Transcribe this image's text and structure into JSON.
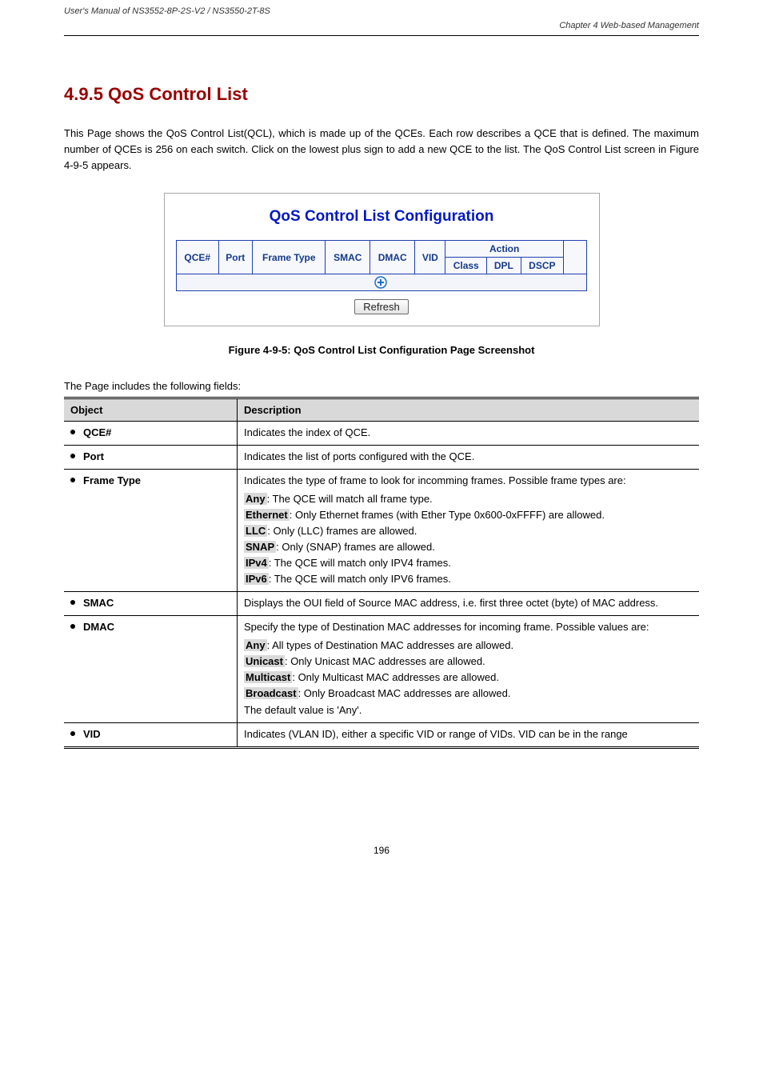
{
  "header": {
    "manual": "User's Manual of NS3552-8P-2S-V2 / NS3550-2T-8S",
    "chapter": "Chapter 4 Web-based Management"
  },
  "section": {
    "heading": "4.9.5 QoS Control List",
    "intro": "This Page shows the QoS Control List(QCL), which is made up of the QCEs. Each row describes a QCE that is defined. The maximum number of QCEs is 256 on each switch. Click on the lowest plus sign to add a new QCE to the list. The QoS Control List screen in Figure 4-9-5 appears."
  },
  "figure": {
    "title": "QoS Control List Configuration",
    "headers": {
      "qce": "QCE#",
      "port": "Port",
      "frame_type": "Frame Type",
      "smac": "SMAC",
      "dmac": "DMAC",
      "vid": "VID",
      "action_group": "Action",
      "class": "Class",
      "dpl": "DPL",
      "dscp": "DSCP"
    },
    "refresh_label": "Refresh",
    "caption_label": "Figure 4-9-5:",
    "caption_text": " QoS Control List Configuration Page Screenshot"
  },
  "lead": "The Page includes the following fields:",
  "table": {
    "head_object": "Object",
    "head_description": "Description",
    "rows": [
      {
        "obj": "QCE#",
        "desc_plain": "Indicates the index of QCE."
      },
      {
        "obj": "Port",
        "desc_plain": "Indicates the list of ports configured with the QCE."
      },
      {
        "obj": "Frame Type",
        "desc_intro": "Indicates the type of frame to look for incomming frames. Possible frame types are:",
        "options": [
          {
            "hl": "Any",
            "rest": ": The QCE will match all frame type."
          },
          {
            "hl": "Ethernet",
            "rest": ": Only Ethernet frames (with Ether Type 0x600-0xFFFF) are allowed."
          },
          {
            "hl": "LLC",
            "rest": ": Only (LLC) frames are allowed."
          },
          {
            "hl": "SNAP",
            "rest": ": Only (SNAP) frames are allowed."
          },
          {
            "hl": "IPv4",
            "rest": ": The QCE will match only IPV4 frames."
          },
          {
            "hl": "IPv6",
            "rest": ": The QCE will match only IPV6 frames."
          }
        ]
      },
      {
        "obj": "SMAC",
        "desc_plain": "Displays the OUI field of Source MAC address, i.e. first three octet (byte) of MAC address."
      },
      {
        "obj": "DMAC",
        "desc_intro": "Specify the type of Destination MAC addresses for incoming frame. Possible values are:",
        "options": [
          {
            "hl": "Any",
            "rest": ": All types of Destination MAC addresses are allowed."
          },
          {
            "hl": "Unicast",
            "rest": ": Only Unicast MAC addresses are allowed."
          },
          {
            "hl": "Multicast",
            "rest": ": Only Multicast MAC addresses are allowed."
          },
          {
            "hl": "Broadcast",
            "rest": ": Only Broadcast MAC addresses are allowed."
          }
        ],
        "trailer": "The default value is 'Any'."
      },
      {
        "obj": "VID",
        "desc_plain": "Indicates (VLAN ID), either a specific VID or range of VIDs. VID can be in the range"
      }
    ]
  },
  "footer": {
    "page_number": "196"
  }
}
